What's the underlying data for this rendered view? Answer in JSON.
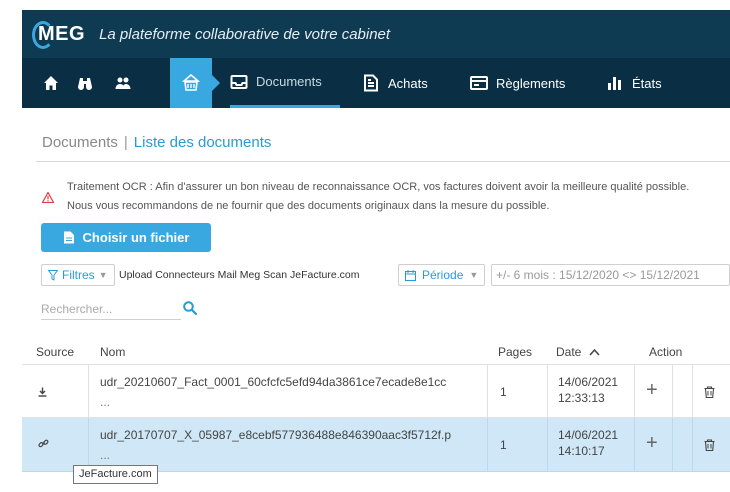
{
  "header": {
    "logo": "MEG",
    "tagline": "La plateforme collaborative de votre cabinet"
  },
  "nav": {
    "tabs": [
      {
        "label": "Documents",
        "icon": "inbox-icon",
        "active": true
      },
      {
        "label": "Achats",
        "icon": "document-icon"
      },
      {
        "label": "Règlements",
        "icon": "card-icon"
      },
      {
        "label": "États",
        "icon": "bar-chart-icon"
      }
    ],
    "accent": "#3aa8e0"
  },
  "breadcrumb": {
    "root": "Documents",
    "separator": "|",
    "current": "Liste des documents"
  },
  "warning": {
    "text": "Traitement OCR : Afin d'assurer un bon niveau de reconnaissance OCR, vos factures doivent avoir la meilleure qualité possible. Nous vous recommandons de ne fournir que des documents originaux dans la mesure du possible."
  },
  "upload": {
    "label": "Choisir un fichier"
  },
  "filters": {
    "label": "Filtres",
    "tags": "Upload Connecteurs Mail Meg Scan JeFacture.com",
    "period_label": "Période",
    "period_value": "+/- 6 mois : 15/12/2020 <> 15/12/2021"
  },
  "search": {
    "placeholder": "Rechercher..."
  },
  "table": {
    "headers": {
      "source": "Source",
      "name": "Nom",
      "pages": "Pages",
      "date": "Date",
      "action": "Action"
    },
    "rows": [
      {
        "source_icon": "download-icon",
        "name": "udr_20210607_Fact_0001_60cfcfc5efd94da3861ce7ecade8e1cc",
        "ellipsis": "...",
        "pages": "1",
        "date": "14/06/2021",
        "time": "12:33:13"
      },
      {
        "source_icon": "link-icon",
        "name": "udr_20170707_X_05987_e8cebf577936488e846390aac3f5712f.p",
        "ellipsis": "...",
        "pages": "1",
        "date": "14/06/2021",
        "time": "14:10:17"
      }
    ]
  },
  "tooltip": {
    "text": "JeFacture.com"
  }
}
